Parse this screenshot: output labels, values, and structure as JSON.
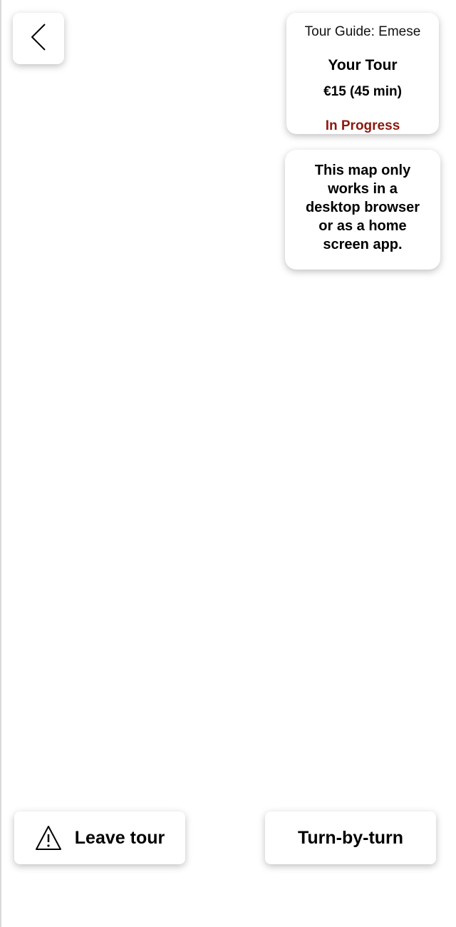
{
  "nav": {
    "back_icon": "chevron-left-icon"
  },
  "tour_info": {
    "guide": "Tour Guide: Emese",
    "title": "Your Tour",
    "price": "€15 (45 min)",
    "status": "In Progress",
    "status_color": "#8c1a10"
  },
  "notice": {
    "line1": "This map only",
    "line2": "works in a",
    "line3": "desktop browser",
    "line4": "or as a home",
    "line5": "screen app."
  },
  "actions": {
    "leave_label": "Leave tour",
    "leave_icon": "warning-icon",
    "turn_by_turn_label": "Turn-by-turn"
  }
}
